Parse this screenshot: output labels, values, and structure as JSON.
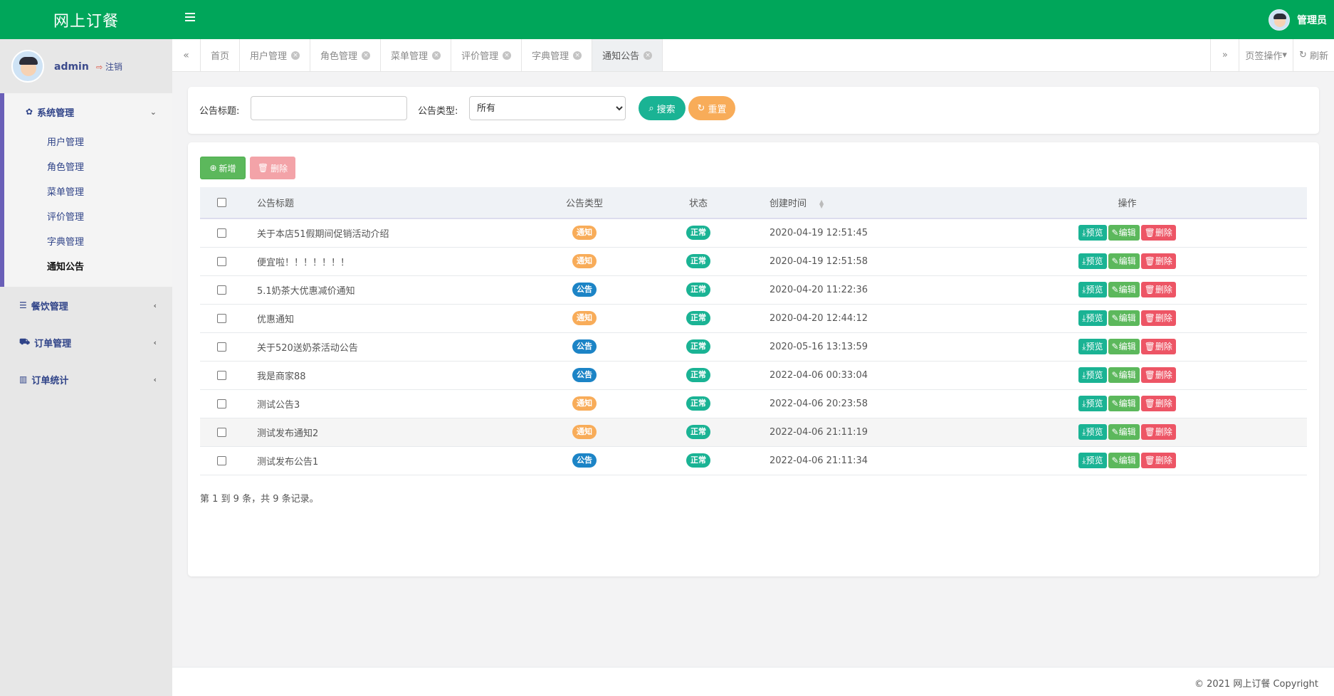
{
  "app": {
    "brand": "网上订餐",
    "user_label": "管理员"
  },
  "sidebar": {
    "username": "admin",
    "logout": "注销",
    "groups": [
      {
        "label": "系统管理",
        "icon": "gear-icon",
        "items": [
          "用户管理",
          "角色管理",
          "菜单管理",
          "评价管理",
          "字典管理",
          "通知公告"
        ]
      },
      {
        "label": "餐饮管理",
        "icon": "list-icon"
      },
      {
        "label": "订单管理",
        "icon": "cart-icon"
      },
      {
        "label": "订单统计",
        "icon": "bar-chart-icon"
      }
    ]
  },
  "tabs": {
    "items": [
      "首页",
      "用户管理",
      "角色管理",
      "菜单管理",
      "评价管理",
      "字典管理",
      "通知公告"
    ],
    "active": "通知公告",
    "page_ops": "页签操作",
    "refresh": "刷新"
  },
  "search": {
    "title_label": "公告标题:",
    "title_value": "",
    "type_label": "公告类型:",
    "type_selected": "所有",
    "search_button": "搜索",
    "reset_button": "重置"
  },
  "toolbar": {
    "add": "新增",
    "delete": "删除"
  },
  "table": {
    "headers": {
      "title": "公告标题",
      "type": "公告类型",
      "status": "状态",
      "created": "创建时间",
      "ops": "操作"
    },
    "rows": [
      {
        "title": "关于本店51假期间促销活动介绍",
        "type": "通知",
        "status": "正常",
        "created": "2020-04-19 12:51:45"
      },
      {
        "title": "便宜啦！！！！！！！",
        "type": "通知",
        "status": "正常",
        "created": "2020-04-19 12:51:58"
      },
      {
        "title": "5.1奶茶大优惠减价通知",
        "type": "公告",
        "status": "正常",
        "created": "2020-04-20 11:22:36"
      },
      {
        "title": "优惠通知",
        "type": "通知",
        "status": "正常",
        "created": "2020-04-20 12:44:12"
      },
      {
        "title": "关于520送奶茶活动公告",
        "type": "公告",
        "status": "正常",
        "created": "2020-05-16 13:13:59"
      },
      {
        "title": "我是商家88",
        "type": "公告",
        "status": "正常",
        "created": "2022-04-06 00:33:04"
      },
      {
        "title": "测试公告3",
        "type": "通知",
        "status": "正常",
        "created": "2022-04-06 20:23:58"
      },
      {
        "title": "测试发布通知2",
        "type": "通知",
        "status": "正常",
        "created": "2022-04-06 21:11:19"
      },
      {
        "title": "测试发布公告1",
        "type": "公告",
        "status": "正常",
        "created": "2022-04-06 21:11:34"
      }
    ],
    "op_labels": {
      "preview": "预览",
      "edit": "编辑",
      "delete": "删除"
    },
    "highlighted_row": 7
  },
  "pager": {
    "info": "第 1 到 9 条，共 9 条记录。"
  },
  "footer": {
    "copyright": "© 2021 网上订餐 Copyright"
  },
  "colors": {
    "topbar": "#00a65a",
    "primary": "#1ab394",
    "warning": "#f8ac59",
    "info": "#1c84c6",
    "danger": "#ed5565",
    "success": "#5cb85c"
  }
}
